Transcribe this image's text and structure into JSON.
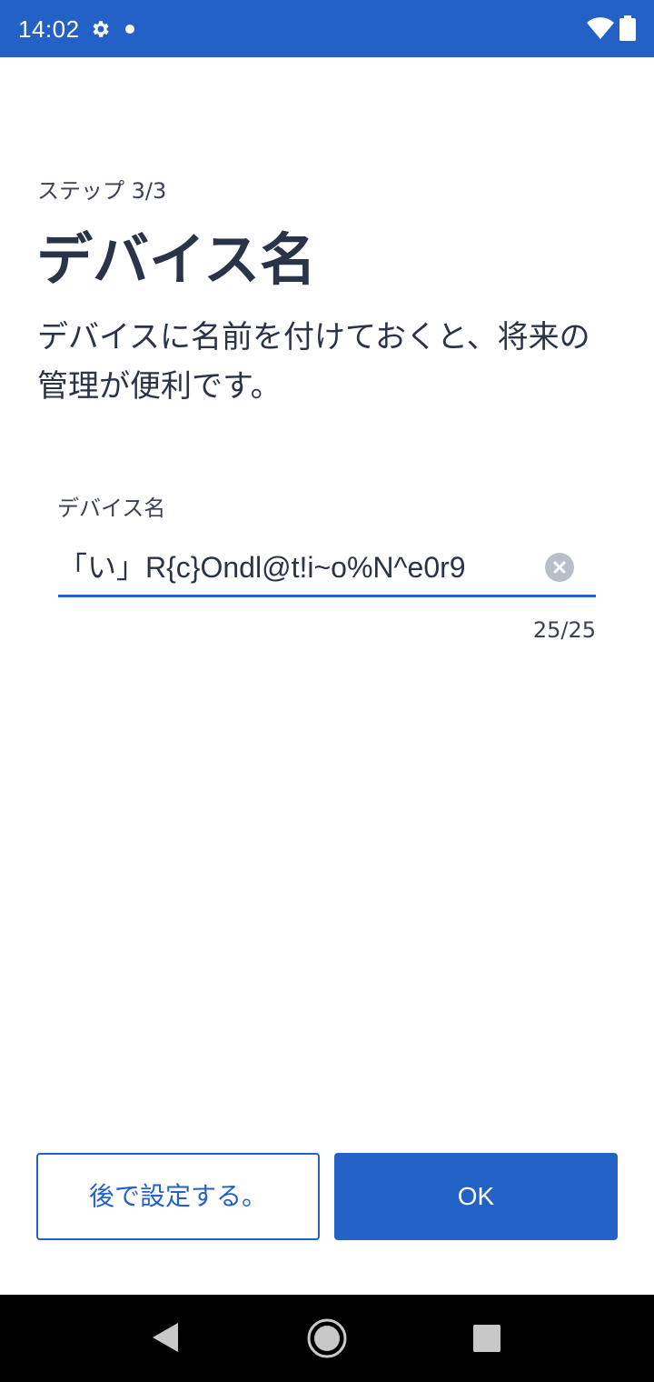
{
  "status_bar": {
    "time": "14:02",
    "icons": [
      "gear-icon",
      "notification-dot-icon",
      "wifi-icon",
      "battery-icon"
    ]
  },
  "header": {
    "step": "ステップ 3/3",
    "title": "デバイス名",
    "description": "デバイスに名前を付けておくと、将来の管理が便利です。"
  },
  "device_name_field": {
    "label": "デバイス名",
    "value": "「い」R{c}Ondl@t!i~o%N^e0r9",
    "counter": "25/25",
    "clear_icon": "clear-circle-icon"
  },
  "actions": {
    "later_label": "後で設定する。",
    "ok_label": "OK"
  },
  "navigation": {
    "icons": [
      "back-icon",
      "home-icon",
      "recents-icon"
    ]
  },
  "colors": {
    "accent": "#2361c7",
    "text": "#2b3447",
    "clear_icon_bg": "#b8bfc9",
    "nav_bar": "#000000"
  }
}
